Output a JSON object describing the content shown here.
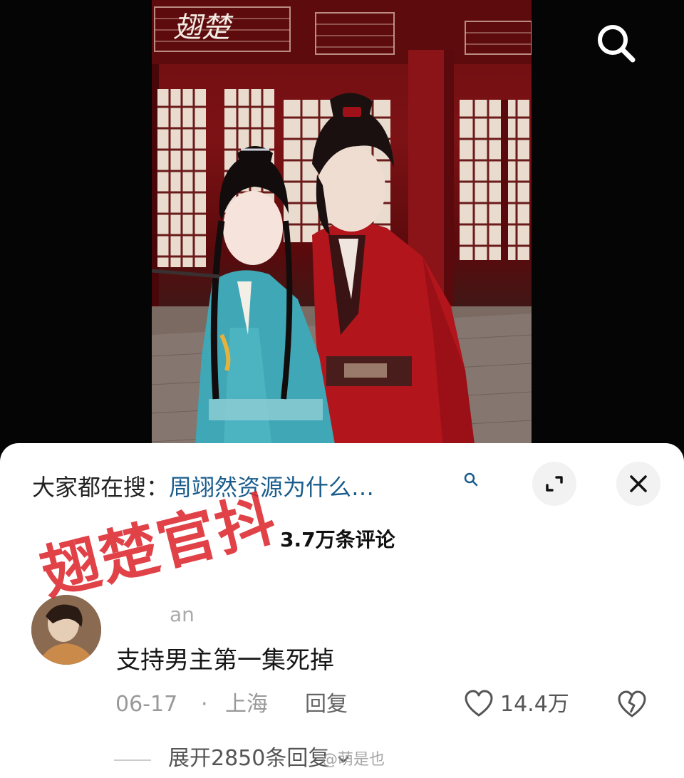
{
  "video": {
    "title_logo": "翅楚"
  },
  "hot_search": {
    "prefix": "大家都在搜：",
    "term": "周翊然资源为什么…"
  },
  "comments": {
    "count_label": "3.7万条评论"
  },
  "comment": {
    "username_partial": "an",
    "text": "支持男主第一集死掉",
    "date": "06-17",
    "separator": "·",
    "location": "上海",
    "reply_label": "回复",
    "like_count": "14.4万",
    "expand_replies": "展开2850条回复"
  },
  "overlay": {
    "stamp_text": "翅楚官抖",
    "watermark": "@萌是也"
  },
  "icons": {
    "search": "search-icon",
    "expand": "expand-icon",
    "close": "close-icon",
    "like": "heart-icon",
    "dislike": "broken-heart-icon",
    "chevron": "chevron-down-icon"
  },
  "colors": {
    "link": "#1a5c8c",
    "stamp": "#dc282d",
    "sheet_bg": "#ffffff"
  }
}
